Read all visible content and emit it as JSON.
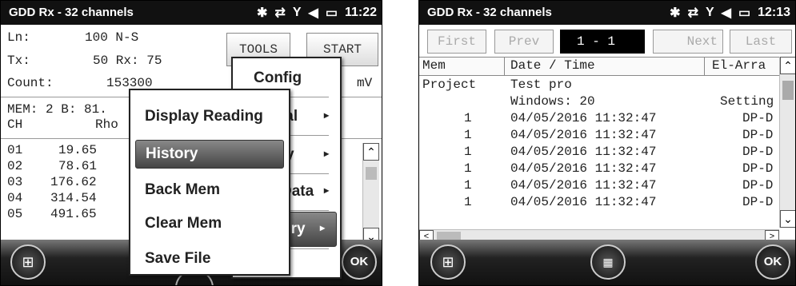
{
  "left": {
    "title": "GDD Rx - 32 channels",
    "time": "11:22",
    "ln_label": "Ln:",
    "ln_value": "100 N-S",
    "tx_label": "Tx:",
    "tx_value": "50 Rx: 75",
    "count_label": "Count:",
    "count_value": "153300",
    "tools_label": "TOOLS",
    "start_label": "START",
    "unit": "mV",
    "mem_text": "MEM: 2 B: 81.",
    "ch_header": "CH",
    "rho_header": "Rho",
    "rows": [
      {
        "ch": "01",
        "rho": "19.65"
      },
      {
        "ch": "02",
        "rho": "78.61"
      },
      {
        "ch": "03",
        "rho": "176.62"
      },
      {
        "ch": "04",
        "rho": "314.54"
      },
      {
        "ch": "05",
        "rho": "491.65"
      }
    ],
    "tools_menu": [
      {
        "label": "Config",
        "arrow": ""
      },
      {
        "label": "ial",
        "arrow": "▸"
      },
      {
        "label": "y",
        "arrow": "▸"
      },
      {
        "label": "Data",
        "arrow": "▸"
      },
      {
        "label": "ory",
        "arrow": "▸"
      },
      {
        "label": "t",
        "arrow": ""
      }
    ],
    "history_menu": [
      {
        "label": "Display Reading"
      },
      {
        "label": "History"
      },
      {
        "label": "Back Mem"
      },
      {
        "label": "Clear Mem"
      },
      {
        "label": "Save File"
      }
    ],
    "ok_label": "OK"
  },
  "right": {
    "title": "GDD Rx - 32 channels",
    "time": "12:13",
    "first_label": "First",
    "prev_label": "Prev",
    "range_value": "1 -    1",
    "next_label": "Next",
    "last_label": "Last",
    "col_mem": "Mem",
    "col_date": "Date / Time",
    "col_array": "El-Arra",
    "project_label": "Project",
    "project_value": "Test pro",
    "windows_text": "Windows: 20",
    "setting_text": "Setting",
    "rows": [
      {
        "mem": "1",
        "date": "04/05/2016 11:32:47",
        "arr": "DP-D"
      },
      {
        "mem": "1",
        "date": "04/05/2016 11:32:47",
        "arr": "DP-D"
      },
      {
        "mem": "1",
        "date": "04/05/2016 11:32:47",
        "arr": "DP-D"
      },
      {
        "mem": "1",
        "date": "04/05/2016 11:32:47",
        "arr": "DP-D"
      },
      {
        "mem": "1",
        "date": "04/05/2016 11:32:47",
        "arr": "DP-D"
      },
      {
        "mem": "1",
        "date": "04/05/2016 11:32:47",
        "arr": "DP-D"
      }
    ],
    "ok_label": "OK"
  }
}
